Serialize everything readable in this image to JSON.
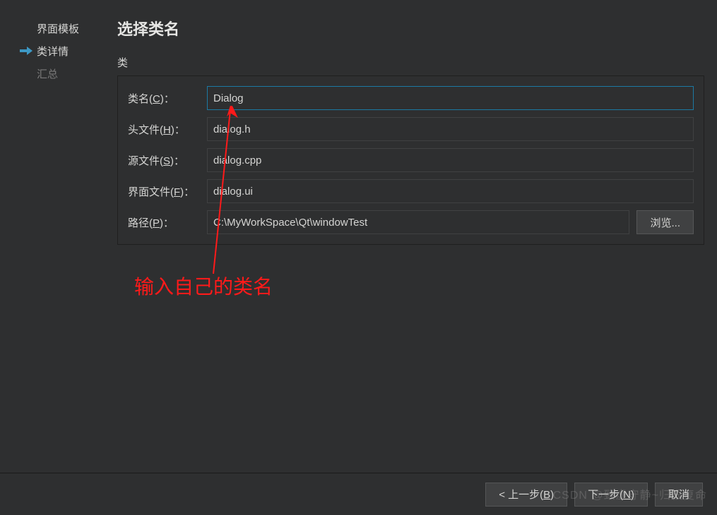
{
  "sidebar": {
    "steps": [
      {
        "label": "界面模板",
        "active": false,
        "muted": false
      },
      {
        "label": "类详情",
        "active": true,
        "muted": false
      },
      {
        "label": "汇总",
        "active": false,
        "muted": true
      }
    ]
  },
  "title": "选择类名",
  "section_label": "类",
  "fields": {
    "class_name": {
      "label_pre": "类名(",
      "hotkey": "C",
      "label_post": ")：",
      "value": "Dialog"
    },
    "header": {
      "label_pre": "头文件(",
      "hotkey": "H",
      "label_post": ")：",
      "value": "dialog.h"
    },
    "source": {
      "label_pre": "源文件(",
      "hotkey": "S",
      "label_post": ")：",
      "value": "dialog.cpp"
    },
    "form": {
      "label_pre": "界面文件(",
      "hotkey": "F",
      "label_post": ")：",
      "value": "dialog.ui"
    },
    "path": {
      "label_pre": "路径(",
      "hotkey": "P",
      "label_post": ")：",
      "value": "C:\\MyWorkSpace\\Qt\\windowTest",
      "browse": "浏览..."
    }
  },
  "annotation": "输入自己的类名",
  "footer": {
    "back": {
      "pre": "< 上一步(",
      "hotkey": "B",
      "post": ")"
    },
    "next": {
      "pre": "下一步(",
      "hotkey": "N",
      "post": ")"
    },
    "cancel": {
      "label": "取消"
    }
  },
  "watermark": "CSDN @致虚守静~归根复命"
}
